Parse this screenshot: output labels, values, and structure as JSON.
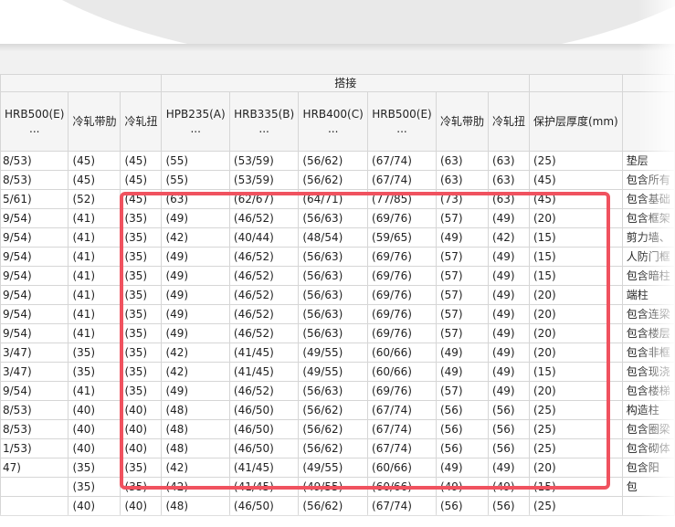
{
  "header": {
    "group_label": "搭接",
    "columns": [
      "HRB500(E)\n...",
      "冷轧带肋",
      "冷轧扭",
      "HPB235(A)\n...",
      "HRB335(B)\n...",
      "HRB400(C)\n...",
      "HRB500(E)\n...",
      "冷轧带肋",
      "冷轧扭",
      "保护层厚度(mm)",
      ""
    ]
  },
  "rows": [
    [
      "8/53)",
      "(45)",
      "(45)",
      "(55)",
      "(53/59)",
      "(56/62)",
      "(67/74)",
      "(63)",
      "(63)",
      "(25)",
      "垫层"
    ],
    [
      "8/53)",
      "(45)",
      "(45)",
      "(55)",
      "(53/59)",
      "(56/62)",
      "(67/74)",
      "(63)",
      "(63)",
      "(45)",
      "包含所有"
    ],
    [
      "5/61)",
      "(52)",
      "(45)",
      "(63)",
      "(62/67)",
      "(64/71)",
      "(77/85)",
      "(73)",
      "(63)",
      "(45)",
      "包含基础"
    ],
    [
      "9/54)",
      "(41)",
      "(35)",
      "(49)",
      "(46/52)",
      "(56/63)",
      "(69/76)",
      "(57)",
      "(49)",
      "(20)",
      "包含框架"
    ],
    [
      "9/54)",
      "(41)",
      "(35)",
      "(42)",
      "(40/44)",
      "(48/54)",
      "(59/65)",
      "(49)",
      "(42)",
      "(15)",
      "剪力墙、"
    ],
    [
      "9/54)",
      "(41)",
      "(35)",
      "(49)",
      "(46/52)",
      "(56/63)",
      "(69/76)",
      "(57)",
      "(49)",
      "(15)",
      "人防门框"
    ],
    [
      "9/54)",
      "(41)",
      "(35)",
      "(49)",
      "(46/52)",
      "(56/63)",
      "(69/76)",
      "(57)",
      "(49)",
      "(15)",
      "包含暗柱"
    ],
    [
      "9/54)",
      "(41)",
      "(35)",
      "(49)",
      "(46/52)",
      "(56/63)",
      "(69/76)",
      "(57)",
      "(49)",
      "(20)",
      "端柱"
    ],
    [
      "9/54)",
      "(41)",
      "(35)",
      "(49)",
      "(46/52)",
      "(56/63)",
      "(69/76)",
      "(57)",
      "(49)",
      "(20)",
      "包含连梁"
    ],
    [
      "9/54)",
      "(41)",
      "(35)",
      "(49)",
      "(46/52)",
      "(56/63)",
      "(69/76)",
      "(57)",
      "(49)",
      "(20)",
      "包含楼层"
    ],
    [
      "3/47)",
      "(35)",
      "(35)",
      "(42)",
      "(41/45)",
      "(49/55)",
      "(60/66)",
      "(49)",
      "(49)",
      "(20)",
      "包含非框"
    ],
    [
      "3/47)",
      "(35)",
      "(35)",
      "(42)",
      "(41/45)",
      "(49/55)",
      "(60/66)",
      "(49)",
      "(49)",
      "(15)",
      "包含现浇"
    ],
    [
      "9/54)",
      "(41)",
      "(35)",
      "(49)",
      "(46/52)",
      "(56/63)",
      "(69/76)",
      "(57)",
      "(49)",
      "(20)",
      "包含楼梯"
    ],
    [
      "8/53)",
      "(40)",
      "(40)",
      "(48)",
      "(46/50)",
      "(56/62)",
      "(67/74)",
      "(56)",
      "(56)",
      "(25)",
      "构造柱"
    ],
    [
      "8/53)",
      "(40)",
      "(40)",
      "(48)",
      "(46/50)",
      "(56/62)",
      "(67/74)",
      "(56)",
      "(56)",
      "(25)",
      "包含圈梁"
    ],
    [
      "1/53)",
      "(40)",
      "(40)",
      "(48)",
      "(46/50)",
      "(56/62)",
      "(67/74)",
      "(56)",
      "(56)",
      "(25)",
      "包含砌体"
    ],
    [
      "47)",
      "(35)",
      "(35)",
      "(42)",
      "(41/45)",
      "(49/55)",
      "(60/66)",
      "(49)",
      "(49)",
      "(20)",
      "包含阳"
    ],
    [
      "",
      "(35)",
      "(35)",
      "(42)",
      "(41/45)",
      "(49/55)",
      "(60/66)",
      "(49)",
      "(49)",
      "(15)",
      "包"
    ],
    [
      "",
      "(40)",
      "(40)",
      "(48)",
      "(46/50)",
      "(56/62)",
      "(67/74)",
      "(56)",
      "(56)",
      "(25)",
      ""
    ]
  ]
}
